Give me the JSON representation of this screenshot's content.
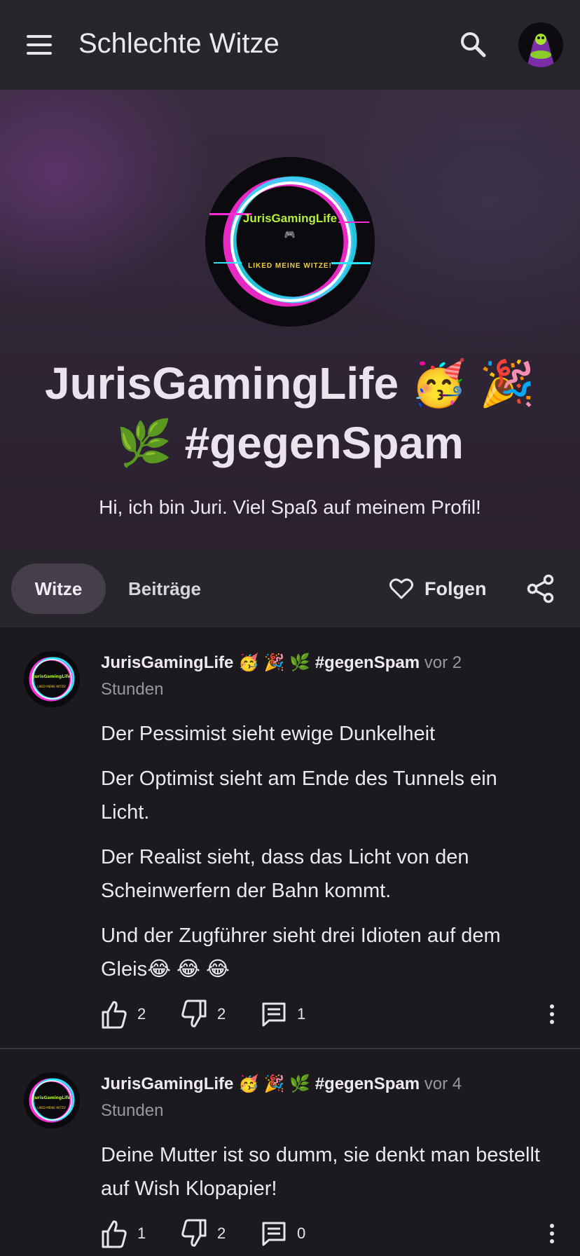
{
  "header": {
    "title": "Schlechte Witze",
    "menu_icon": "hamburger-menu-icon",
    "search_icon": "search-icon",
    "account_icon": "user-avatar"
  },
  "profile": {
    "logo_text": "JurisGamingLife",
    "logo_tagline": "LIKED MEINE WITZE!",
    "logo_icon": "🎮",
    "name": "JurisGamingLife 🥳 🎉 🌿 #gegenSpam",
    "bio": "Hi, ich bin Juri. Viel Spaß auf meinem Profil!"
  },
  "tabs": [
    {
      "label": "Witze",
      "active": true
    },
    {
      "label": "Beiträge",
      "active": false
    }
  ],
  "actions": {
    "follow_label": "Folgen",
    "follow_icon": "heart-outline-icon",
    "share_icon": "share-icon"
  },
  "posts": [
    {
      "author": "JurisGamingLife 🥳 🎉 🌿 #gegenSpam",
      "time": "vor 2 Stunden",
      "paragraphs": [
        "Der Pessimist sieht ewige Dunkelheit",
        "Der Optimist sieht am Ende des Tunnels ein Licht.",
        "Der Realist sieht, dass das Licht von den Scheinwerfern der Bahn kommt.",
        "Und der Zugführer sieht drei Idioten auf dem Gleis😂 😂 😂"
      ],
      "likes": "2",
      "dislikes": "2",
      "comments": "1"
    },
    {
      "author": "JurisGamingLife 🥳 🎉 🌿 #gegenSpam",
      "time": "vor 4 Stunden",
      "paragraphs": [
        "Deine Mutter ist so dumm, sie denkt man bestellt auf Wish Klopapier!"
      ],
      "likes": "1",
      "dislikes": "2",
      "comments": "0"
    }
  ],
  "colors": {
    "background": "#1c191f",
    "bar": "#28252b",
    "active_tab": "#453f4b",
    "logo_ring_pink": "#ff2bd6",
    "logo_ring_cyan": "#28e6ff",
    "logo_text_green": "#b6f03c"
  }
}
